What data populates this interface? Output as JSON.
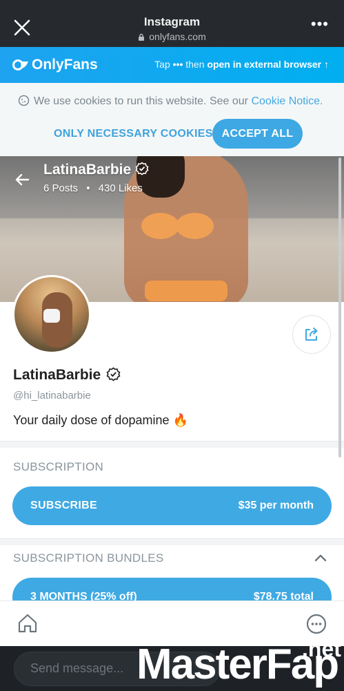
{
  "browser": {
    "title": "Instagram",
    "url": "onlyfans.com",
    "close_icon": "close-icon",
    "more_label": "•••"
  },
  "ofbar": {
    "logo_text": "OnlyFans",
    "tap_label": "Tap",
    "dots": "•••",
    "then_label": "then",
    "open_label": "open in external browser",
    "arrow": "↑"
  },
  "cookie": {
    "message": "We use cookies to run this website. See our",
    "link": "Cookie Notice.",
    "necessary_label": "ONLY NECESSARY COOKIES",
    "accept_label": "ACCEPT ALL"
  },
  "cover": {
    "name": "LatinaBarbie",
    "posts": "6 Posts",
    "sep": "•",
    "likes": "430 Likes"
  },
  "profile": {
    "name": "LatinaBarbie",
    "handle": "@hi_latinabarbie",
    "bio": "Your daily dose of dopamine 🔥"
  },
  "subscription": {
    "title": "SUBSCRIPTION",
    "button_label": "SUBSCRIBE",
    "price": "$35 per month"
  },
  "bundles": {
    "title": "SUBSCRIPTION BUNDLES",
    "items": [
      {
        "label": "3 MONTHS (25% off)",
        "price": "$78.75 total"
      }
    ]
  },
  "message": {
    "placeholder": "Send message..."
  },
  "watermark": {
    "part1": "Master",
    "part2": "Fap",
    "net": ".net"
  },
  "colors": {
    "accent": "#00aff0",
    "button": "#3fa9e3",
    "header": "#262a2e"
  }
}
